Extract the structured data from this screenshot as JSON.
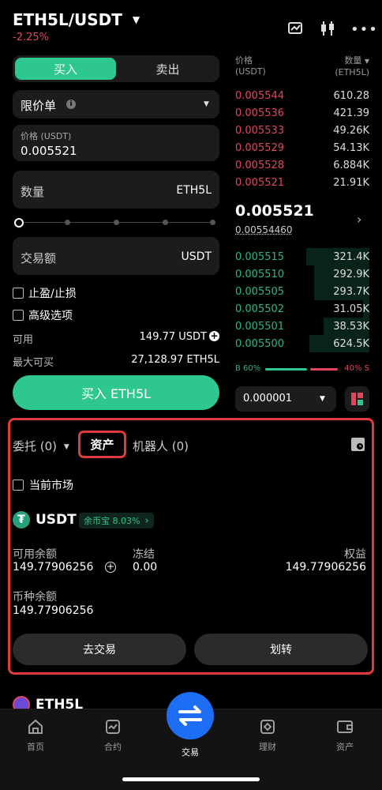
{
  "header": {
    "pair": "ETH5L/USDT",
    "change": "-2.25%"
  },
  "order_form": {
    "buy_tab": "买入",
    "sell_tab": "卖出",
    "order_type": "限价单",
    "price_label": "价格 (USDT)",
    "price_value": "0.005521",
    "qty_label": "数量",
    "qty_unit": "ETH5L",
    "amount_label": "交易额",
    "amount_unit": "USDT",
    "tp_sl": "止盈/止损",
    "advanced": "高级选项",
    "available_label": "可用",
    "available_value": "149.77 USDT",
    "max_buy_label": "最大可买",
    "max_buy_value": "27,128.97 ETH5L",
    "buy_button": "买入 ETH5L",
    "slider_fraction": 0
  },
  "orderbook": {
    "price_header": "价格",
    "price_unit": "(USDT)",
    "qty_header": "数量",
    "qty_unit": "(ETH5L)",
    "asks": [
      {
        "price": "0.005544",
        "qty": "610.28"
      },
      {
        "price": "0.005536",
        "qty": "421.39"
      },
      {
        "price": "0.005533",
        "qty": "49.26K"
      },
      {
        "price": "0.005529",
        "qty": "54.13K"
      },
      {
        "price": "0.005528",
        "qty": "6.884K"
      },
      {
        "price": "0.005521",
        "qty": "21.91K"
      }
    ],
    "last_price": "0.005521",
    "index_price": "0.00554460",
    "bids": [
      {
        "price": "0.005515",
        "qty": "321.4K"
      },
      {
        "price": "0.005510",
        "qty": "292.9K"
      },
      {
        "price": "0.005505",
        "qty": "293.7K"
      },
      {
        "price": "0.005502",
        "qty": "31.05K"
      },
      {
        "price": "0.005501",
        "qty": "38.53K"
      },
      {
        "price": "0.005500",
        "qty": "624.5K"
      }
    ],
    "buy_ratio": "B 60%",
    "sell_ratio": "40% S",
    "buy_fraction": 0.6,
    "precision": "0.000001"
  },
  "assets_panel": {
    "tab_orders": "委托 (0)",
    "tab_assets": "资产",
    "tab_bots": "机器人 (0)",
    "current_market": "当前市场",
    "coin": "USDT",
    "earn_badge": "余币宝 8.03%",
    "available_label": "可用余额",
    "available_value": "149.77906256",
    "frozen_label": "冻结",
    "frozen_value": "0.00",
    "equity_label": "权益",
    "equity_value": "149.77906256",
    "coin_balance_label": "币种余额",
    "coin_balance_value": "149.77906256",
    "trade_button": "去交易",
    "transfer_button": "划转"
  },
  "below": {
    "coin": "ETH5L"
  },
  "bottom_nav": [
    {
      "label": "首页",
      "icon": "home-icon"
    },
    {
      "label": "合约",
      "icon": "futures-icon"
    },
    {
      "label": "交易",
      "icon": "trade-swap-icon"
    },
    {
      "label": "理财",
      "icon": "finance-icon"
    },
    {
      "label": "资产",
      "icon": "wallet-icon"
    }
  ],
  "colors": {
    "green": "#2dc78f",
    "red": "#e0475c",
    "nav_accent": "#1e6ef5",
    "highlight": "#e03a3a"
  }
}
